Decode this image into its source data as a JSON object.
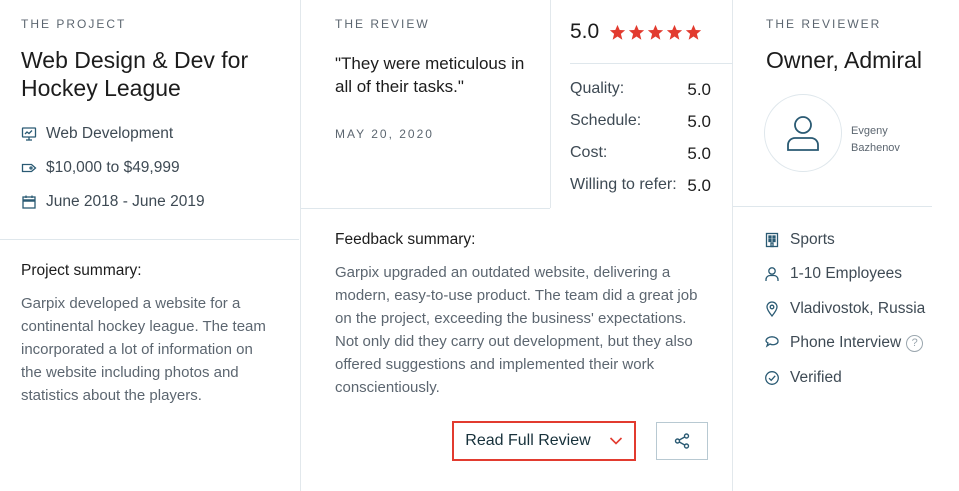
{
  "project": {
    "eyebrow": "THE PROJECT",
    "title": "Web Design & Dev for Hockey League",
    "meta": [
      {
        "icon": "monitor-icon",
        "text": "Web Development"
      },
      {
        "icon": "price-tag-icon",
        "text": "$10,000 to $49,999"
      },
      {
        "icon": "calendar-icon",
        "text": "June 2018 - June 2019"
      }
    ],
    "summary_label": "Project summary:",
    "summary_text": "Garpix developed a website for a continental hockey league. The team incorporated a lot of information on the website including photos and statistics about the players."
  },
  "review": {
    "eyebrow": "THE REVIEW",
    "quote": "\"They were meticulous in all of their tasks.\"",
    "date": "MAY 20, 2020",
    "overall": "5.0",
    "star_count": 5,
    "star_color": "#e23b2f",
    "scores": [
      {
        "label": "Quality:",
        "value": "5.0"
      },
      {
        "label": "Schedule:",
        "value": "5.0"
      },
      {
        "label": "Cost:",
        "value": "5.0"
      },
      {
        "label": "Willing to refer:",
        "value": "5.0"
      }
    ],
    "feedback_label": "Feedback summary:",
    "feedback_text": "Garpix upgraded an outdated website, delivering a modern, easy-to-use product. The team did a great job on the project, exceeding the business' expectations. Not only did they carry out development, but they also offered suggestions and implemented their work conscientiously.",
    "read_full_label": "Read Full Review",
    "highlight_color": "#e23b2f"
  },
  "reviewer": {
    "eyebrow": "THE REVIEWER",
    "title": "Owner, Admiral",
    "name": "Evgeny Bazhenov",
    "info": [
      {
        "icon": "building-icon",
        "text": "Sports"
      },
      {
        "icon": "user-icon",
        "text": "1-10 Employees"
      },
      {
        "icon": "location-pin-icon",
        "text": "Vladivostok, Russia"
      },
      {
        "icon": "chat-bubble-icon",
        "text": "Phone Interview"
      },
      {
        "icon": "check-circle-icon",
        "text": "Verified"
      }
    ],
    "help_glyph": "?"
  }
}
